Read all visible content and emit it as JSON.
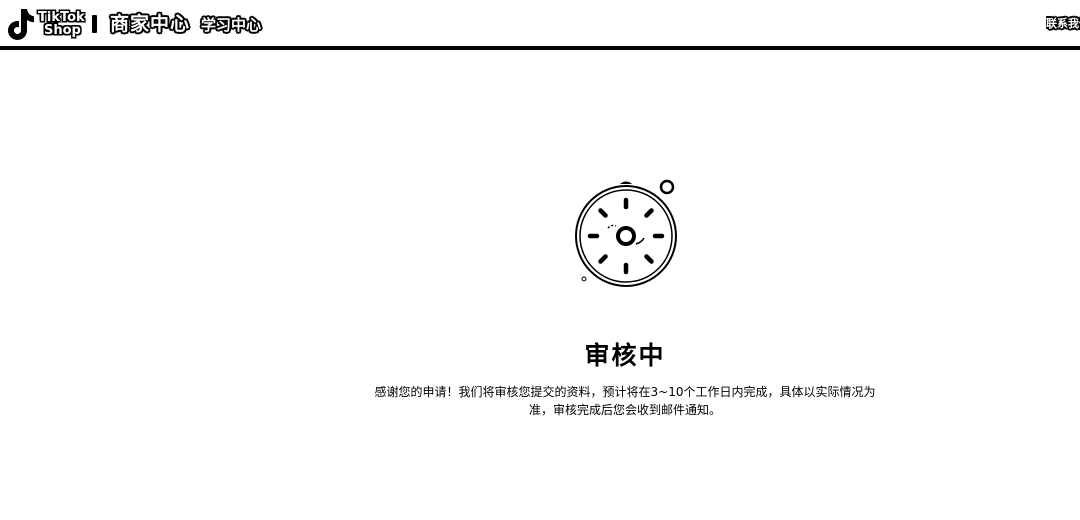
{
  "header": {
    "logo_line1": "TikTok",
    "logo_line2": "Shop",
    "brand_title": "商家中心",
    "learn_link": "学习中心",
    "contact_label": "联系我们"
  },
  "main": {
    "illustration": "review-dial-icon",
    "status_title": "审核中",
    "description": "感谢您的申请！我们将审核您提交的资料，预计将在3~10个工作日内完成，具体以实际情况为准，审核完成后您会收到邮件通知。"
  },
  "colors": {
    "background": "#ffffff",
    "text": "#000000",
    "header_border": "#000000"
  }
}
